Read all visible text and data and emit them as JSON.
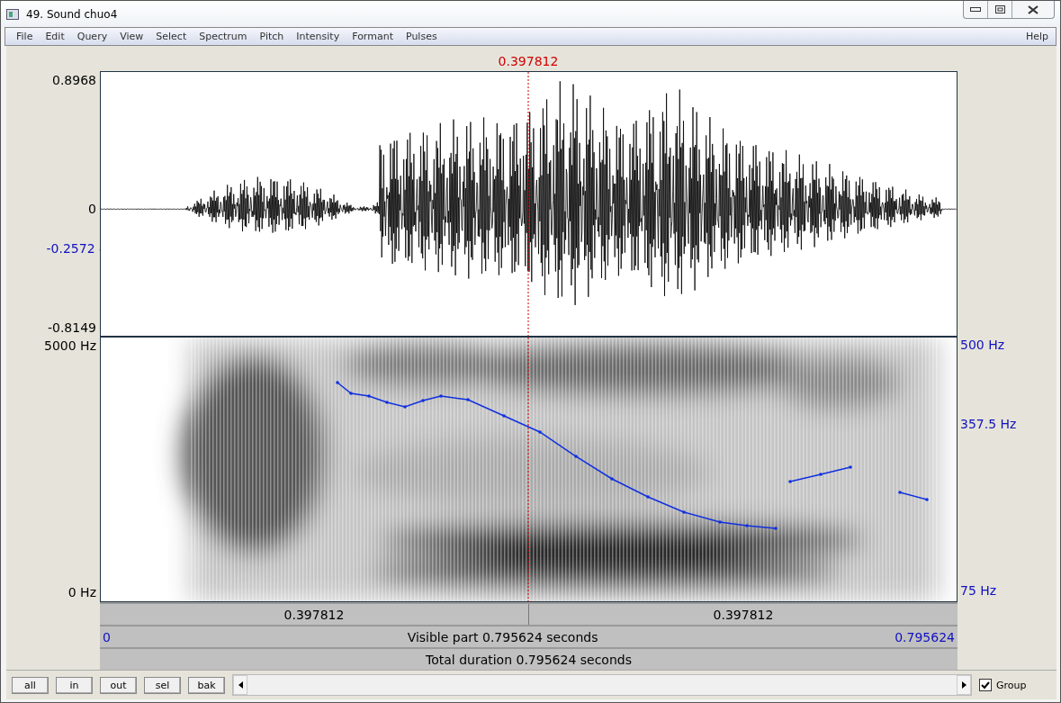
{
  "window": {
    "title": "49. Sound chuo4"
  },
  "menu": {
    "items": [
      "File",
      "Edit",
      "Query",
      "View",
      "Select",
      "Spectrum",
      "Pitch",
      "Intensity",
      "Formant",
      "Pulses"
    ],
    "help": "Help"
  },
  "cursor": {
    "time": "0.397812"
  },
  "waveform": {
    "labels": [
      {
        "text": "0.8968",
        "kind": "limit"
      },
      {
        "text": "0",
        "kind": "limit"
      },
      {
        "text": "-0.2572",
        "kind": "cursor"
      },
      {
        "text": "-0.8149",
        "kind": "limit"
      }
    ]
  },
  "spectrogram": {
    "left_labels": [
      {
        "text": "5000 Hz"
      },
      {
        "text": "0 Hz"
      }
    ],
    "right_labels": [
      {
        "text": "500 Hz"
      },
      {
        "text": "357.5 Hz"
      },
      {
        "text": "75 Hz"
      }
    ]
  },
  "time_bars": {
    "halves": [
      "0.397812",
      "0.397812"
    ],
    "visible": {
      "start": "0",
      "label": "Visible part 0.795624 seconds",
      "end": "0.795624"
    },
    "total": "Total duration 0.795624 seconds"
  },
  "buttons": [
    "all",
    "in",
    "out",
    "sel",
    "bak"
  ],
  "group": {
    "label": "Group",
    "checked": true
  }
}
